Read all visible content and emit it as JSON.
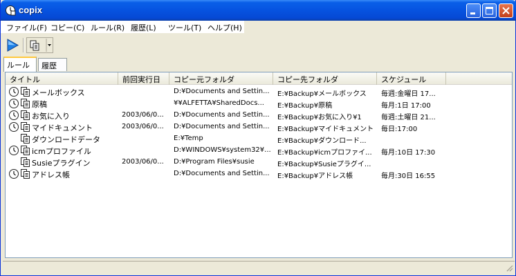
{
  "window": {
    "title": "copix"
  },
  "menu": [
    "ファイル(F)",
    "コピー(C)",
    "ルール(R)",
    "履歴(L)",
    "ツール(T)",
    "ヘルプ(H)"
  ],
  "toolbar": {
    "run_icon": "play-icon",
    "copy_icon": "clipboard-copy-icon",
    "dropdown_icon": "dropdown-arrow-icon"
  },
  "tabs": [
    {
      "label": "ルール",
      "active": true
    },
    {
      "label": "履歴",
      "active": false
    }
  ],
  "columns": [
    "タイトル",
    "前回実行日",
    "コピー元フォルダ",
    "コピー先フォルダ",
    "スケジュール"
  ],
  "rows": [
    {
      "title": "メールボックス",
      "last_run": "",
      "source": "D:¥Documents and Settin...",
      "dest": "E:¥Backup¥メールボックス",
      "schedule": "毎週:金曜日 17...",
      "scheduled": true
    },
    {
      "title": "原稿",
      "last_run": "",
      "source": "¥¥ALFETTA¥SharedDocs...",
      "dest": "E:¥Backup¥原稿",
      "schedule": "毎月:1日 17:00",
      "scheduled": true
    },
    {
      "title": "お気に入り",
      "last_run": "2003/06/0...",
      "source": "D:¥Documents and Settin...",
      "dest": "E:¥Backup¥お気に入り¥1",
      "schedule": "毎週:土曜日 21...",
      "scheduled": true
    },
    {
      "title": "マイドキュメント",
      "last_run": "2003/06/0...",
      "source": "D:¥Documents and Settin...",
      "dest": "E:¥Backup¥マイドキュメント",
      "schedule": "毎日:17:00",
      "scheduled": true
    },
    {
      "title": "ダウンロードデータ",
      "last_run": "",
      "source": "E:¥Temp",
      "dest": "E:¥Backup¥ダウンロード...",
      "schedule": "",
      "scheduled": false
    },
    {
      "title": "icmプロファイル",
      "last_run": "",
      "source": "D:¥WINDOWS¥system32¥...",
      "dest": "E:¥Backup¥icmプロファイ...",
      "schedule": "毎月:10日 17:30",
      "scheduled": true
    },
    {
      "title": "Susieプラグイン",
      "last_run": "2003/06/0...",
      "source": "D:¥Program Files¥susie",
      "dest": "E:¥Backup¥Susieプラグイ...",
      "schedule": "",
      "scheduled": false
    },
    {
      "title": "アドレス帳",
      "last_run": "",
      "source": "D:¥Documents and Settin...",
      "dest": "E:¥Backup¥アドレス帳",
      "schedule": "毎月:30日 16:55",
      "scheduled": true
    }
  ]
}
